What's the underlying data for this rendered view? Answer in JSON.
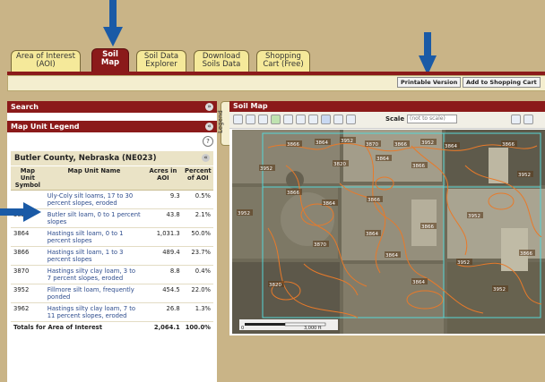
{
  "tabs": [
    {
      "label": "Area of Interest (AOI)",
      "active": false
    },
    {
      "label": "Soil Map",
      "active": true
    },
    {
      "label": "Soil Data Explorer",
      "active": false
    },
    {
      "label": "Download Soils Data",
      "active": false
    },
    {
      "label": "Shopping Cart (Free)",
      "active": false
    }
  ],
  "toolbar": {
    "printable_label": "Printable Version",
    "cart_label": "Add to Shopping Cart"
  },
  "left": {
    "search_title": "Search",
    "legend_title": "Map Unit Legend",
    "county_title": "Butler County, Nebraska (NE023)"
  },
  "legend_table": {
    "headers": {
      "symbol": "Map Unit Symbol",
      "name": "Map Unit Name",
      "acres": "Acres in AOI",
      "percent": "Percent of AOI"
    },
    "rows": [
      {
        "symbol": "",
        "name": "Uly-Coly silt loams, 17 to 30 percent slopes, eroded",
        "acres": "9.3",
        "percent": "0.5%"
      },
      {
        "symbol": "3820",
        "name": "Butler silt loam, 0 to 1 percent slopes",
        "acres": "43.8",
        "percent": "2.1%"
      },
      {
        "symbol": "3864",
        "name": "Hastings silt loam, 0 to 1 percent slopes",
        "acres": "1,031.3",
        "percent": "50.0%"
      },
      {
        "symbol": "3866",
        "name": "Hastings silt loam, 1 to 3 percent slopes",
        "acres": "489.4",
        "percent": "23.7%"
      },
      {
        "symbol": "3870",
        "name": "Hastings silty clay loam, 3 to 7 percent slopes, eroded",
        "acres": "8.8",
        "percent": "0.4%"
      },
      {
        "symbol": "3952",
        "name": "Fillmore silt loam, frequently ponded",
        "acres": "454.5",
        "percent": "22.0%"
      },
      {
        "symbol": "3962",
        "name": "Hastings silty clay loam, 7 to 11 percent slopes, eroded",
        "acres": "26.8",
        "percent": "1.3%"
      }
    ],
    "totals": {
      "label": "Totals for Area of Interest",
      "acres": "2,064.1",
      "percent": "100.0%"
    }
  },
  "legend_side_tab": "Legend",
  "map": {
    "title": "Soil Map",
    "scale_label": "Scale",
    "scale_value": "(not to scale)",
    "scalebar_start": "0",
    "scalebar_end": "3,000 ft",
    "map_labels": [
      "3866",
      "3864",
      "3952",
      "3870",
      "3866",
      "3952",
      "3864",
      "3866",
      "3952",
      "3820",
      "3864",
      "3866",
      "3952",
      "3866",
      "3864",
      "3866",
      "3952",
      "3864",
      "3866",
      "3952",
      "3870",
      "3864",
      "3952",
      "3866",
      "3820",
      "3864",
      "3952"
    ]
  },
  "colors": {
    "tab_active": "#8b1a1a",
    "header": "#8b1a1a",
    "background": "#c9b487",
    "arrow": "#1a5aa6",
    "soil_lines": "#e87a2a",
    "aoi_outline": "#55d6d6"
  }
}
